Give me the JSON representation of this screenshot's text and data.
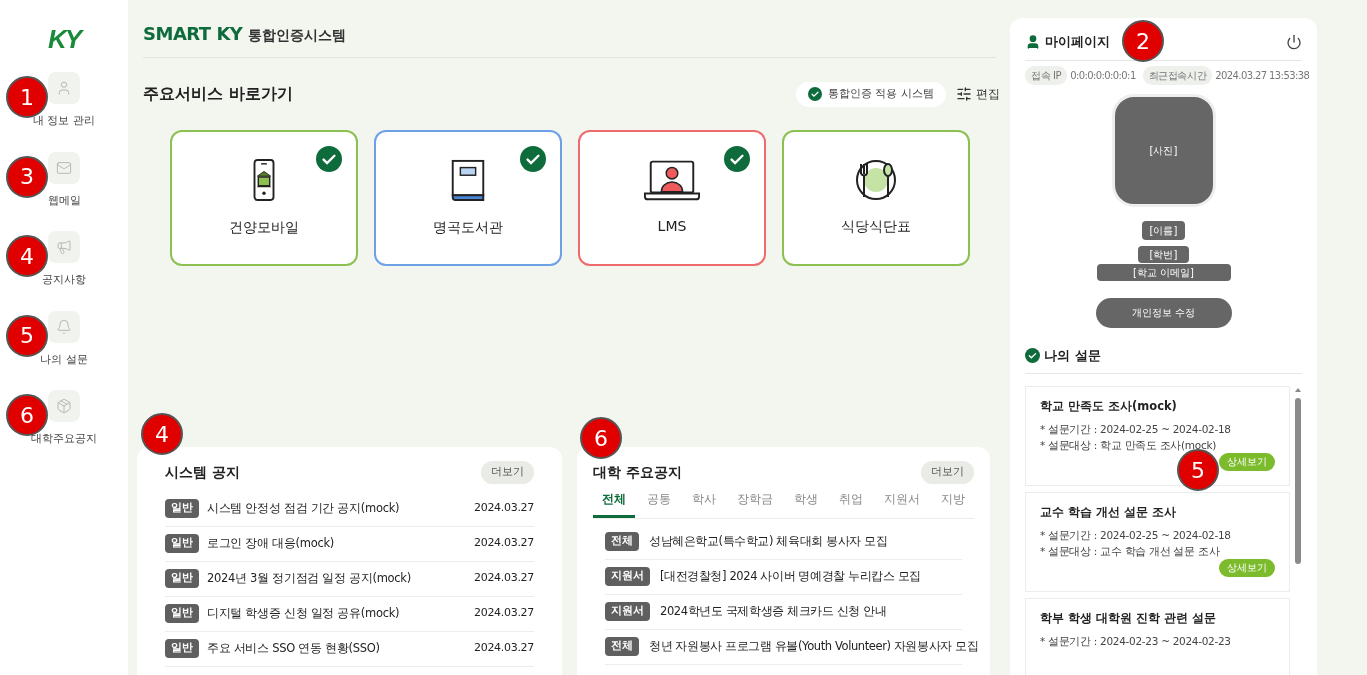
{
  "logo": {
    "text": "KY"
  },
  "sidebar": {
    "items": [
      {
        "label": "내 정보 관리",
        "kind": "user",
        "callout": "1"
      },
      {
        "label": "웹메일",
        "kind": "mail",
        "callout": "3"
      },
      {
        "label": "공지사항",
        "kind": "megaphone",
        "callout": "4"
      },
      {
        "label": "나의 설문",
        "kind": "bell",
        "callout": "5"
      },
      {
        "label": "대학주요공지",
        "kind": "box",
        "callout": "6"
      }
    ]
  },
  "header": {
    "brand": "SMART KY",
    "title": "통합인증시스템"
  },
  "shortcuts": {
    "title": "주요서비스 바로가기",
    "legend": "통합인증 적용 시스템",
    "edit": "편집",
    "items": [
      {
        "label": "건양모바일",
        "kind": "mobile",
        "color": "#8cc152",
        "sso": true
      },
      {
        "label": "명곡도서관",
        "kind": "book",
        "color": "#6ea0e8",
        "sso": true
      },
      {
        "label": "LMS",
        "kind": "laptop",
        "color": "#ef6b6b",
        "sso": true
      },
      {
        "label": "식당식단표",
        "kind": "meal",
        "color": "#8cc152",
        "sso": false
      }
    ]
  },
  "system_notice": {
    "title": "시스템 공지",
    "more": "더보기",
    "callout": "4",
    "rows": [
      {
        "tag": "일반",
        "title": "시스템 안정성 점검 기간 공지(mock)",
        "date": "2024.03.27"
      },
      {
        "tag": "일반",
        "title": "로그인 장애 대응(mock)",
        "date": "2024.03.27"
      },
      {
        "tag": "일반",
        "title": "2024년 3월 정기점검 일정 공지(mock)",
        "date": "2024.03.27"
      },
      {
        "tag": "일반",
        "title": "디지털 학생증 신청 일정 공유(mock)",
        "date": "2024.03.27"
      },
      {
        "tag": "일반",
        "title": "주요 서비스 SSO 연동 현황(SSO)",
        "date": "2024.03.27"
      }
    ]
  },
  "university_notice": {
    "title": "대학 주요공지",
    "more": "더보기",
    "callout": "6",
    "tabs": [
      {
        "label": "전체",
        "selected": true
      },
      {
        "label": "공통",
        "selected": false
      },
      {
        "label": "학사",
        "selected": false
      },
      {
        "label": "장학금",
        "selected": false
      },
      {
        "label": "학생",
        "selected": false
      },
      {
        "label": "취업",
        "selected": false
      },
      {
        "label": "지원서",
        "selected": false
      },
      {
        "label": "지방",
        "selected": false
      }
    ],
    "rows": [
      {
        "tag": "전체",
        "title": "성남혜은학교(특수학교) 체육대회 봉사자 모집"
      },
      {
        "tag": "지원서",
        "title": "[대전경찰청] 2024 사이버 명예경찰 누리캅스 모집"
      },
      {
        "tag": "지원서",
        "title": "2024학년도 국제학생증 체크카드 신청 안내"
      },
      {
        "tag": "전체",
        "title": "청년 자원봉사 프로그램 유볼(Youth Volunteer) 자원봉사자 모집"
      }
    ]
  },
  "mypage": {
    "title": "마이페이지",
    "callout": "2",
    "ip_label": "접속 IP",
    "ip": "0:0:0:0:0:0:0:1",
    "login_label": "최근접속시간",
    "login_time": "2024.03.27 13:53:38",
    "photo": "[사진]",
    "name": "[이름]",
    "student_id": "[학번]",
    "email": "[학교 이메일]",
    "edit_button": "개인정보 수정"
  },
  "surveys": {
    "title": "나의 설문",
    "items": [
      {
        "title": "학교 만족도 조사(mock)",
        "period": "* 설문기간 : 2024-02-25 ~ 2024-02-18",
        "target": "* 설문대상 : 학교 만족도 조사(mock)",
        "button": "상세보기",
        "callout": "5"
      },
      {
        "title": "교수 학습 개선 설문 조사",
        "period": "* 설문기간 : 2024-02-25 ~ 2024-02-18",
        "target": "* 설문대상 : 교수 학습 개선 설문 조사",
        "button": "상세보기"
      },
      {
        "title": "학부 학생 대학원 진학 관련 설문",
        "period": "* 설문기간 : 2024-02-23 ~ 2024-02-23"
      }
    ]
  }
}
